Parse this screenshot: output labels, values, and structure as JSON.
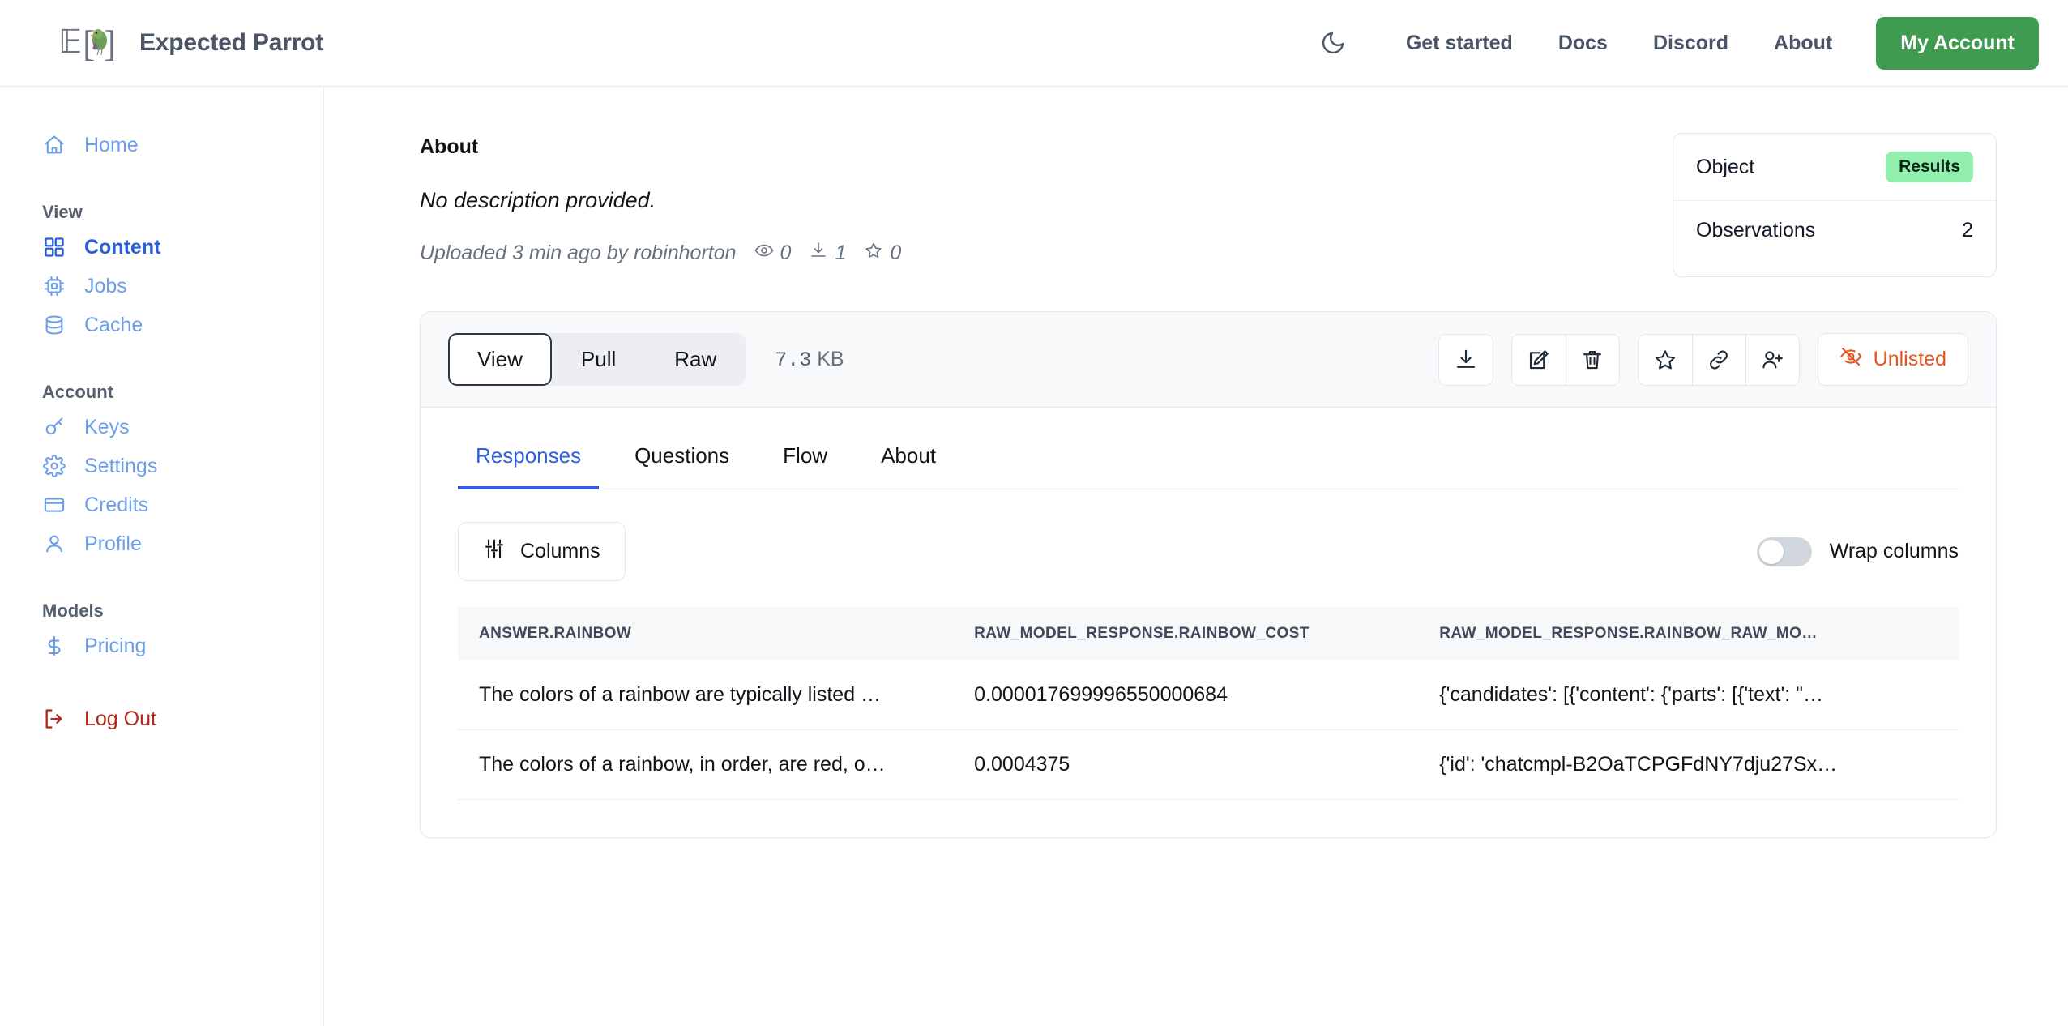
{
  "header": {
    "brand_name": "Expected Parrot",
    "logo_icon": "parrot-logo",
    "theme_toggle_icon": "moon-icon",
    "nav": [
      {
        "label": "Get started"
      },
      {
        "label": "Docs"
      },
      {
        "label": "Discord"
      },
      {
        "label": "About"
      }
    ],
    "account_button": "My Account",
    "account_button_color": "#3e9b4f"
  },
  "sidebar": {
    "home": {
      "label": "Home",
      "icon": "home-icon"
    },
    "groups": [
      {
        "title": "View",
        "items": [
          {
            "label": "Content",
            "icon": "grid-icon",
            "active": true
          },
          {
            "label": "Jobs",
            "icon": "cpu-icon",
            "active": false
          },
          {
            "label": "Cache",
            "icon": "database-icon",
            "active": false
          }
        ]
      },
      {
        "title": "Account",
        "items": [
          {
            "label": "Keys",
            "icon": "key-icon",
            "active": false
          },
          {
            "label": "Settings",
            "icon": "gear-icon",
            "active": false
          },
          {
            "label": "Credits",
            "icon": "credit-card-icon",
            "active": false
          },
          {
            "label": "Profile",
            "icon": "user-icon",
            "active": false
          }
        ]
      },
      {
        "title": "Models",
        "items": [
          {
            "label": "Pricing",
            "icon": "dollar-icon",
            "active": false
          }
        ]
      }
    ],
    "logout": {
      "label": "Log Out",
      "icon": "logout-icon",
      "color": "#b3261e"
    }
  },
  "about": {
    "title": "About",
    "description": "No description provided.",
    "uploaded_text": "Uploaded 3 min ago by robinhorton",
    "stats": [
      {
        "icon": "eye-icon",
        "value": "0"
      },
      {
        "icon": "download-icon",
        "value": "1"
      },
      {
        "icon": "star-icon",
        "value": "0"
      }
    ]
  },
  "object_card": {
    "object_label": "Object",
    "object_badge": "Results",
    "badge_color": "#91efad",
    "observations_label": "Observations",
    "observations_value": "2"
  },
  "toolbar": {
    "segments": [
      {
        "label": "View",
        "active": true
      },
      {
        "label": "Pull",
        "active": false
      },
      {
        "label": "Raw",
        "active": false
      }
    ],
    "file_size_number": "7.3",
    "file_size_unit": "KB",
    "actions": [
      {
        "name": "download-icon"
      },
      {
        "name": "edit-icon"
      },
      {
        "name": "trash-icon"
      },
      {
        "name": "star-icon"
      },
      {
        "name": "link-icon"
      },
      {
        "name": "add-user-icon"
      }
    ],
    "visibility_label": "Unlisted",
    "visibility_icon": "eye-off-icon",
    "visibility_color": "#e2561f"
  },
  "tabs": [
    {
      "label": "Responses",
      "active": true
    },
    {
      "label": "Questions",
      "active": false
    },
    {
      "label": "Flow",
      "active": false
    },
    {
      "label": "About",
      "active": false
    }
  ],
  "table_controls": {
    "columns_button": "Columns",
    "columns_icon": "sliders-icon",
    "wrap_label": "Wrap columns",
    "wrap_enabled": false
  },
  "table": {
    "columns": [
      "ANSWER.RAINBOW",
      "RAW_MODEL_RESPONSE.RAINBOW_COST",
      "RAW_MODEL_RESPONSE.RAINBOW_RAW_MO…"
    ],
    "rows": [
      {
        "answer": "The colors of a rainbow are typically listed …",
        "cost": "0.000017699996550000684",
        "raw": "{'candidates': [{'content': {'parts': [{'text': \"…"
      },
      {
        "answer": "The colors of a rainbow, in order, are red, o…",
        "cost": "0.0004375",
        "raw": "{'id': 'chatcmpl-B2OaTCPGFdNY7dju27Sx…"
      }
    ]
  }
}
